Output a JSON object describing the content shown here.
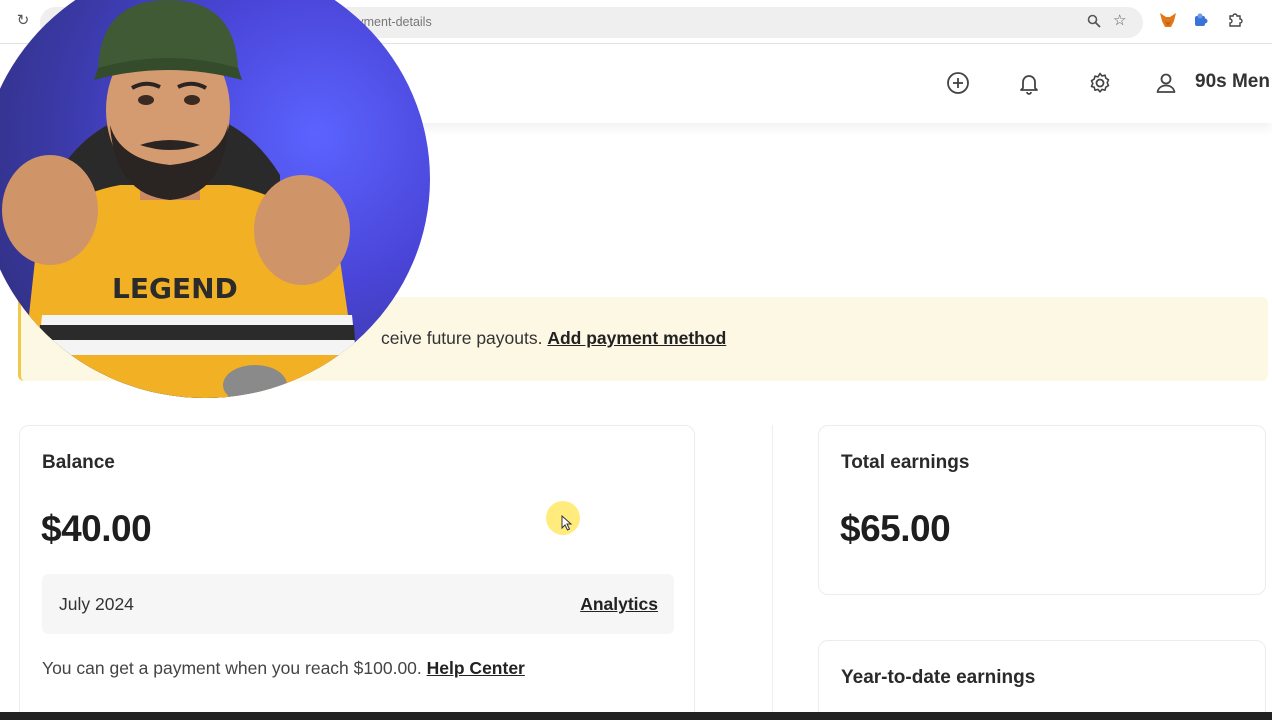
{
  "browser": {
    "url": "/payment-details"
  },
  "header": {
    "account_name": "90s Men"
  },
  "notice": {
    "text": "ceive future payouts. ",
    "link_label": "Add payment method"
  },
  "balance": {
    "label": "Balance",
    "amount": "$40.00",
    "month": "July 2024",
    "analytics_label": "Analytics",
    "note": "You can get a payment when you reach $100.00. ",
    "help_label": "Help Center"
  },
  "total_earnings": {
    "label": "Total earnings",
    "amount": "$65.00"
  },
  "ytd_earnings": {
    "label": "Year-to-date earnings"
  },
  "webcam": {
    "shirt_text": "LEGEND"
  },
  "colors": {
    "notice_bg": "#fdf8e4",
    "notice_accent": "#f0c94a",
    "webcam_bg": "#4a45d8",
    "shirt": "#f2b024"
  },
  "icons": [
    "reload-icon",
    "zoom-icon",
    "star-icon",
    "metamask-icon",
    "extension-icon",
    "puzzle-icon",
    "add-icon",
    "bell-icon",
    "gear-icon",
    "user-icon"
  ]
}
